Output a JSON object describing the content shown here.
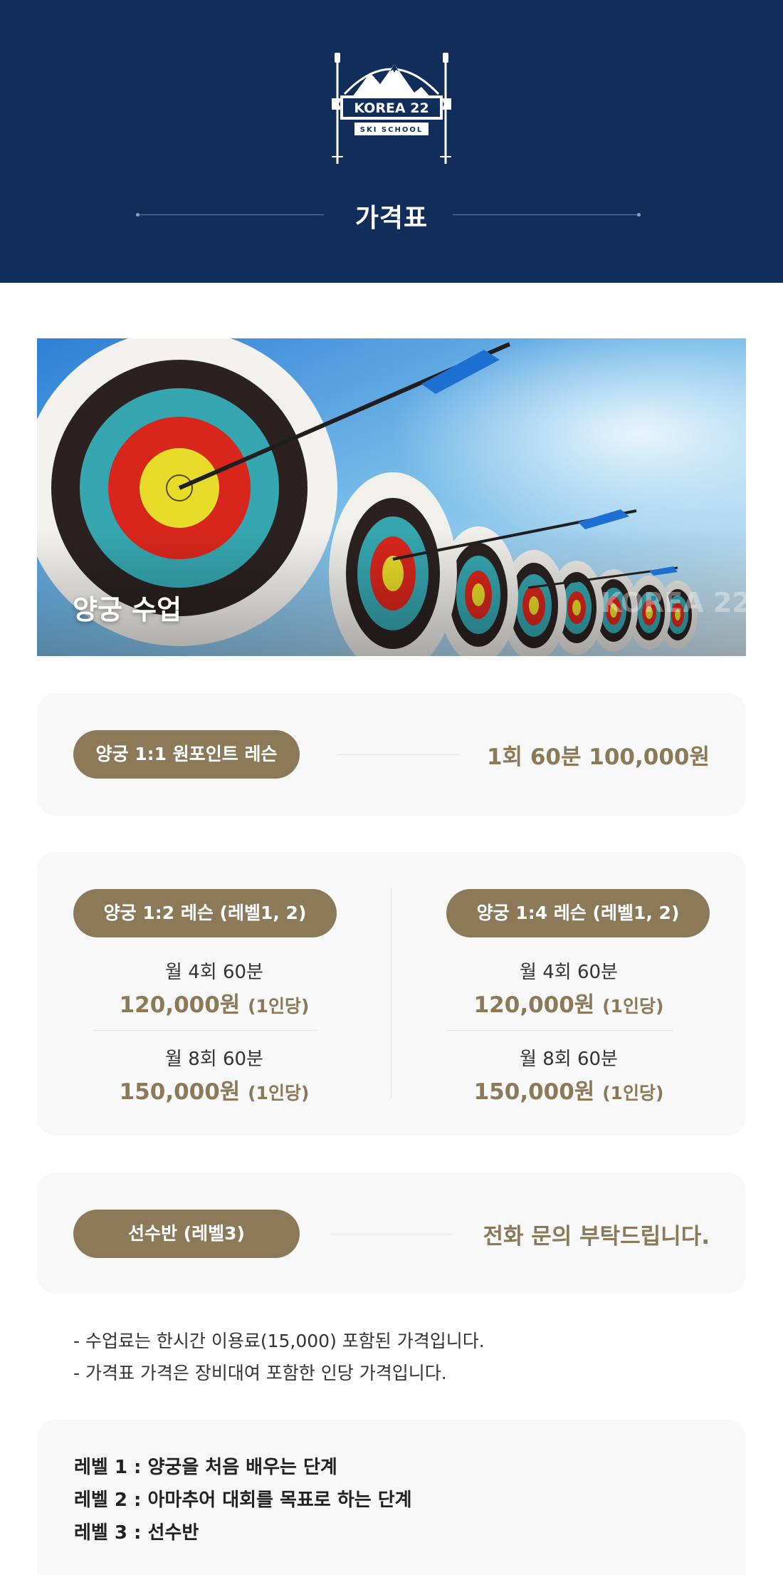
{
  "header": {
    "logo_text": "KOREA 22",
    "logo_subtext": "SKI SCHOOL",
    "title": "가격표"
  },
  "hero": {
    "label": "양궁 수업",
    "watermark": "KOREA 22"
  },
  "card_onepoint": {
    "label": "양궁 1:1 원포인트 레슨",
    "price": "1회 60분 100,000원"
  },
  "card_group": {
    "left": {
      "label": "양궁 1:2 레슨 (레벨1, 2)",
      "options": [
        {
          "freq": "월 4회 60분",
          "amount": "120,000원",
          "per": "(1인당)"
        },
        {
          "freq": "월 8회 60분",
          "amount": "150,000원",
          "per": "(1인당)"
        }
      ]
    },
    "right": {
      "label": "양궁 1:4 레슨 (레벨1, 2)",
      "options": [
        {
          "freq": "월 4회 60분",
          "amount": "120,000원",
          "per": "(1인당)"
        },
        {
          "freq": "월 8회 60분",
          "amount": "150,000원",
          "per": "(1인당)"
        }
      ]
    }
  },
  "card_athlete": {
    "label": "선수반 (레벨3)",
    "price": "전화 문의 부탁드립니다."
  },
  "notes": [
    "- 수업료는 한시간 이용료(15,000) 포함된 가격입니다.",
    "- 가격표 가격은 장비대여 포함한 인당 가격입니다."
  ],
  "levels": [
    "레벨 1 : 양궁을 처음 배우는 단계",
    "레벨 2 : 아마추어 대회를 목표로 하는 단계",
    "레벨 3 : 선수반"
  ],
  "colors": {
    "header_bg": "#112e5b",
    "accent": "#8b7958",
    "card_bg": "#f8f8f8"
  }
}
